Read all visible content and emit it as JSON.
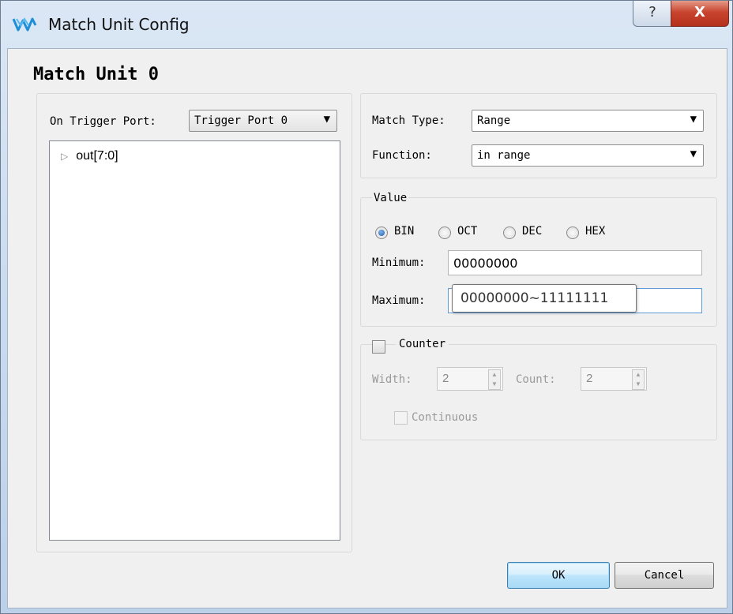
{
  "window": {
    "title": "Match Unit Config",
    "help_glyph": "?",
    "close_glyph": "X",
    "accent": "#3c7fb1"
  },
  "heading": "Match Unit 0",
  "trigger": {
    "label": "On Trigger Port:",
    "selected": "Trigger Port 0",
    "tree": [
      {
        "label": "out[7:0]",
        "icon": "expand-triangle-icon"
      }
    ]
  },
  "match": {
    "type_label": "Match Type:",
    "type_value": "Range",
    "function_label": "Function:",
    "function_value": "in range"
  },
  "value": {
    "group_label": "Value",
    "radix": [
      {
        "label": "BIN",
        "selected": true
      },
      {
        "label": "OCT",
        "selected": false
      },
      {
        "label": "DEC",
        "selected": false
      },
      {
        "label": "HEX",
        "selected": false
      }
    ],
    "minimum_label": "Minimum:",
    "minimum_value": "00000000",
    "maximum_label": "Maximum:",
    "maximum_value": "00000111"
  },
  "counter": {
    "label": "Counter",
    "checked": false,
    "width_label": "Width:",
    "width_value": "2",
    "count_label": "Count:",
    "count_value": "2",
    "continuous_label": "Continuous"
  },
  "tooltip": "00000000~11111111",
  "buttons": {
    "ok": "OK",
    "cancel": "Cancel"
  }
}
